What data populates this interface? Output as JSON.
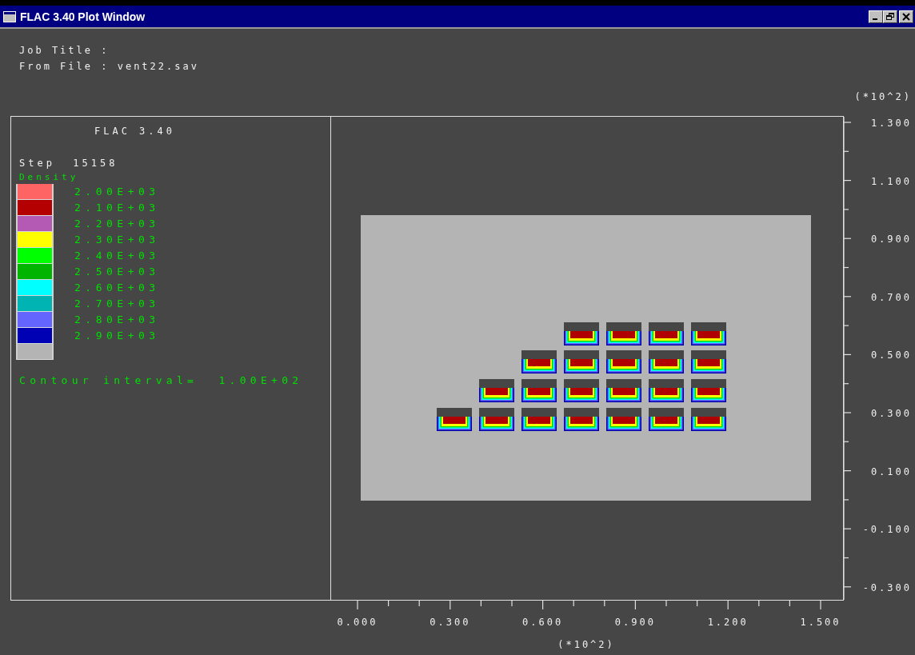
{
  "window": {
    "title": "FLAC 3.40 Plot Window"
  },
  "header": {
    "job_title": "Job Title :",
    "from_file": "From File : vent22.sav"
  },
  "legend": {
    "title": "FLAC 3.40",
    "step": "Step  15158",
    "quantity": "Density",
    "swatches": [
      {
        "color": "#ff6464"
      },
      {
        "color": "#b40000"
      },
      {
        "color": "#b45ab4"
      },
      {
        "color": "#ffff00"
      },
      {
        "color": "#00ff00"
      },
      {
        "color": "#00b400"
      },
      {
        "color": "#00ffff"
      },
      {
        "color": "#00b4b4"
      },
      {
        "color": "#6464ff"
      },
      {
        "color": "#0000b4"
      },
      {
        "color": "#b4b4b4"
      }
    ],
    "values": [
      "2.00E+03",
      "2.10E+03",
      "2.20E+03",
      "2.30E+03",
      "2.40E+03",
      "2.50E+03",
      "2.60E+03",
      "2.70E+03",
      "2.80E+03",
      "2.90E+03"
    ],
    "contour_interval": "Contour interval=  1.00E+02"
  },
  "plot": {
    "y_scale": "(*10^2)",
    "y_ticks": [
      "1.300",
      "1.100",
      "0.900",
      "0.700",
      "0.500",
      "0.300",
      "0.100",
      "-0.100",
      "-0.300"
    ],
    "x_ticks": [
      "0.000",
      "0.300",
      "0.600",
      "0.900",
      "1.200",
      "1.500"
    ],
    "x_scale": "(*10^2)"
  }
}
